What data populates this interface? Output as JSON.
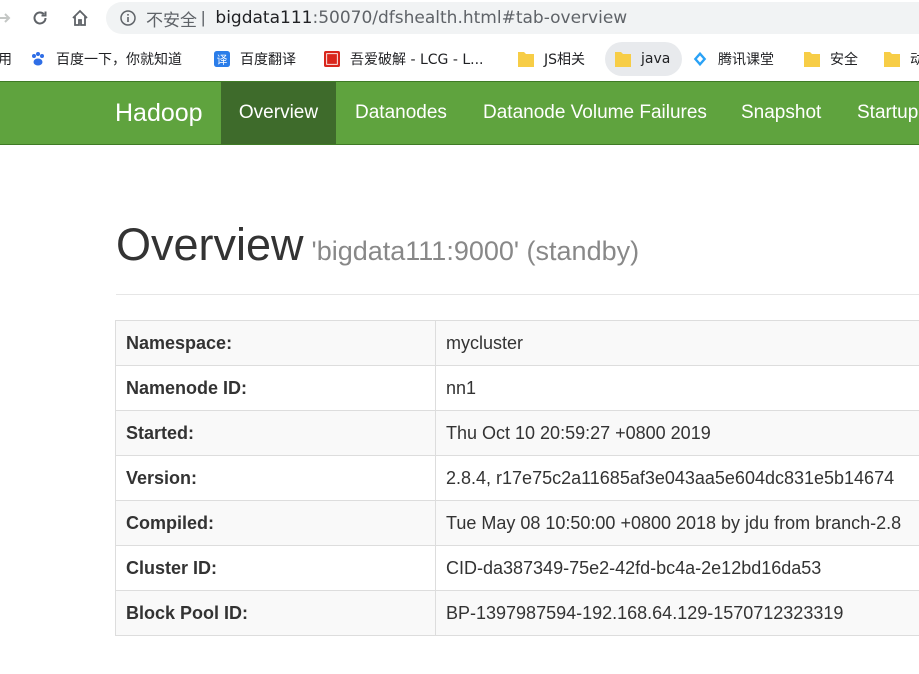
{
  "browser": {
    "security_label": "不安全",
    "separator": "|",
    "url_host": "bigdata111",
    "url_rest": ":50070/dfshealth.html#tab-overview"
  },
  "bookmarks": [
    {
      "label": "用",
      "icon": "apps-icon"
    },
    {
      "label": "百度一下，你就知道",
      "icon": "baidu-paw-icon"
    },
    {
      "label": "百度翻译",
      "icon": "translate-icon"
    },
    {
      "label": "吾爱破解 - LCG - L...",
      "icon": "52pojie-icon"
    },
    {
      "label": "JS相关",
      "icon": "folder-icon"
    },
    {
      "label": "java",
      "icon": "folder-icon"
    },
    {
      "label": "腾讯课堂",
      "icon": "tencent-class-icon"
    },
    {
      "label": "安全",
      "icon": "folder-icon"
    },
    {
      "label": "动",
      "icon": "folder-icon"
    }
  ],
  "navbar": {
    "brand": "Hadoop",
    "tabs": [
      "Overview",
      "Datanodes",
      "Datanode Volume Failures",
      "Snapshot",
      "Startup"
    ],
    "active_tab": "Overview",
    "color": "#5fa33e",
    "active_color": "#3e6b2b"
  },
  "page": {
    "title": "Overview",
    "subtitle": "'bigdata111:9000' (standby)"
  },
  "overview_table": [
    {
      "key": "Namespace:",
      "value": "mycluster"
    },
    {
      "key": "Namenode ID:",
      "value": "nn1"
    },
    {
      "key": "Started:",
      "value": "Thu Oct 10 20:59:27 +0800 2019"
    },
    {
      "key": "Version:",
      "value": "2.8.4, r17e75c2a11685af3e043aa5e604dc831e5b14674"
    },
    {
      "key": "Compiled:",
      "value": "Tue May 08 10:50:00 +0800 2018 by jdu from branch-2.8"
    },
    {
      "key": "Cluster ID:",
      "value": "CID-da387349-75e2-42fd-bc4a-2e12bd16da53"
    },
    {
      "key": "Block Pool ID:",
      "value": "BP-1397987594-192.168.64.129-1570712323319"
    }
  ]
}
